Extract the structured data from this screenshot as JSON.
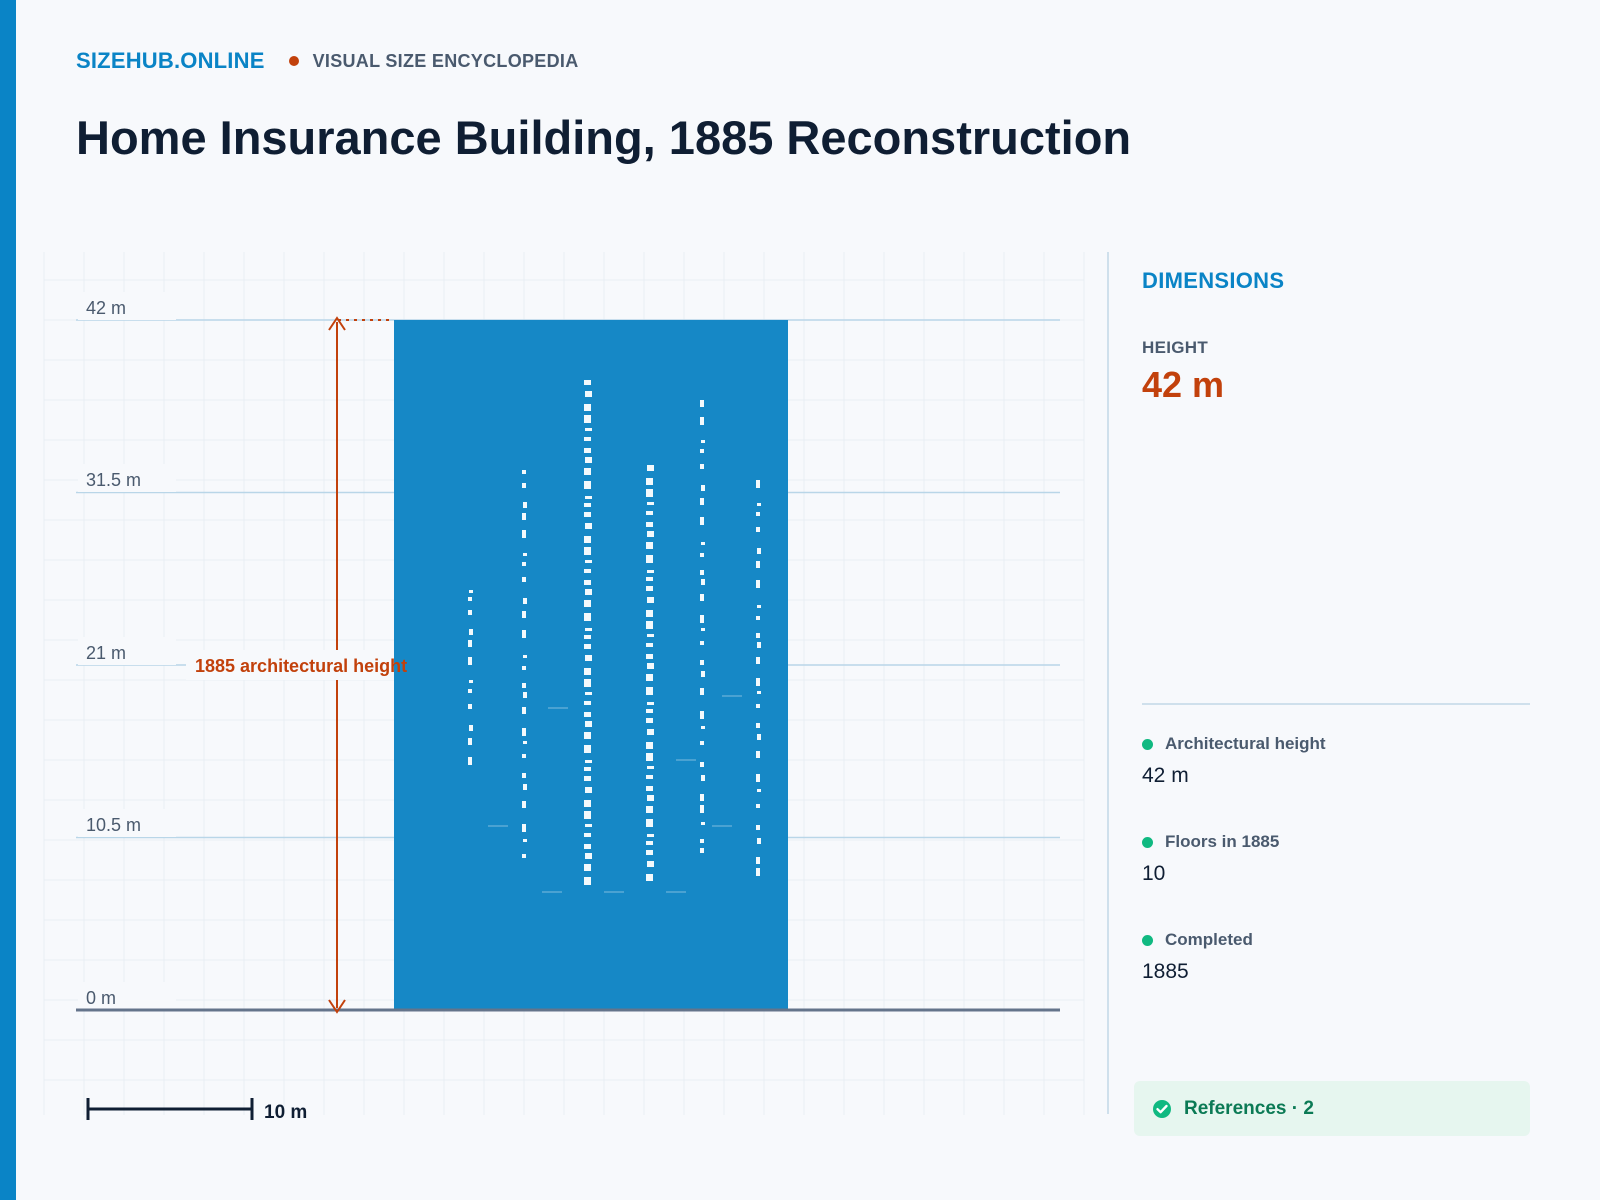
{
  "header": {
    "brand": "SIZEHUB.ONLINE",
    "tagline": "VISUAL SIZE ENCYCLOPEDIA",
    "title": "Home Insurance Building, 1885 Reconstruction"
  },
  "diagram": {
    "axis_max_m": 42,
    "ticks": [
      {
        "value": 0,
        "label": "0 m"
      },
      {
        "value": 10.5,
        "label": "10.5 m"
      },
      {
        "value": 21,
        "label": "21 m"
      },
      {
        "value": 31.5,
        "label": "31.5 m"
      },
      {
        "value": 42,
        "label": "42 m"
      }
    ],
    "building_height_m": 42,
    "dimension_label": "1885 architectural height",
    "scale_bar_m": 10,
    "scale_bar_label": "10 m",
    "colors": {
      "building": "#1688c6",
      "dimension": "#c2410c",
      "ground": "#64748b",
      "tick_line": "#b9d6e8"
    }
  },
  "panel": {
    "title": "DIMENSIONS",
    "height_label": "HEIGHT",
    "height_value": "42 m",
    "stats": [
      {
        "label": "Architectural height",
        "value": "42 m"
      },
      {
        "label": "Floors in 1885",
        "value": "10"
      },
      {
        "label": "Completed",
        "value": "1885"
      }
    ],
    "stat_dot_color": "#10b981"
  },
  "references": {
    "label": "References · 2",
    "icon": "check-circle-icon"
  }
}
